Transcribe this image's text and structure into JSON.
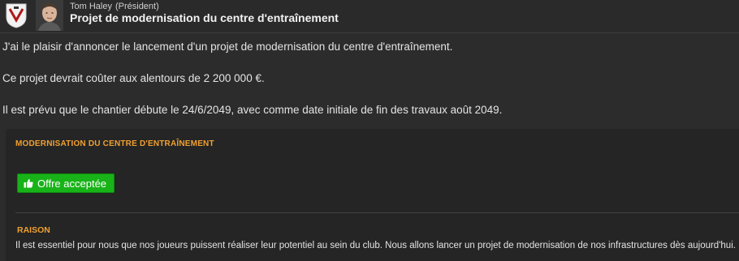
{
  "header": {
    "sender_name": "Tom Haley",
    "sender_role": "(Président)",
    "subject": "Projet de modernisation du centre d'entraînement"
  },
  "message": {
    "paragraph_1": "J'ai le plaisir d'annoncer le lancement d'un projet de modernisation du centre d'entraînement.",
    "paragraph_2": "Ce projet devrait coûter aux alentours de 2 200 000 €.",
    "paragraph_3": "Il est prévu que le chantier débute le 24/6/2049, avec comme date initiale de fin des travaux août 2049."
  },
  "panel": {
    "section_title": "MODERNISATION DU CENTRE D'ENTRAÎNEMENT",
    "accept_button_label": "Offre acceptée",
    "reason_title": "RAISON",
    "reason_text": "Il est essentiel pour nous que nos joueurs puissent réaliser leur potentiel au sein du club. Nous allons lancer un projet de modernisation de nos infrastructures dès aujourd'hui."
  },
  "colors": {
    "background": "#2c2c2c",
    "panel": "#252525",
    "accent_orange": "#f0a030",
    "accept_green": "#18b318"
  },
  "icons": {
    "club_badge": "club-crest-icon",
    "avatar": "person-avatar",
    "accept": "thumbs-up-icon"
  }
}
